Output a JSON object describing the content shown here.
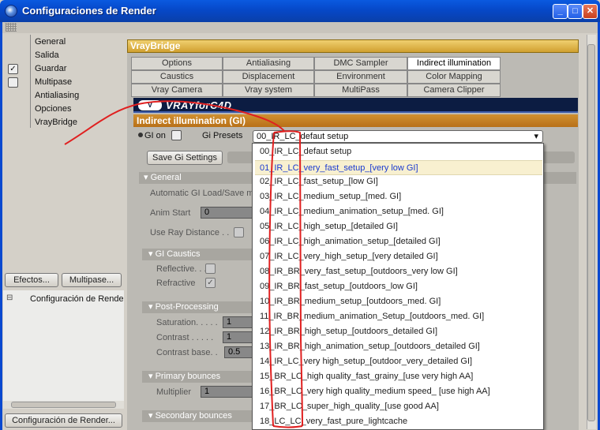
{
  "window": {
    "title": "Configuraciones de Render",
    "min_glyph": "_",
    "max_glyph": "□",
    "close_glyph": "✕"
  },
  "sidebar": {
    "items": [
      {
        "label": "General",
        "checkbox": false
      },
      {
        "label": "Salida",
        "checkbox": false
      },
      {
        "label": "Guardar",
        "checkbox": true,
        "checked": true
      },
      {
        "label": "Multipase",
        "checkbox": true,
        "checked": false
      },
      {
        "label": "Antialiasing",
        "checkbox": false
      },
      {
        "label": "Opciones",
        "checkbox": false
      },
      {
        "label": "VrayBridge",
        "checkbox": false
      }
    ],
    "effects_button": "Efectos...",
    "multipass_button": "Multipase...",
    "render_config_label": "Configuración de Render",
    "render_config_button": "Configuración de Render...",
    "check_glyph": "✓",
    "expand_glyph": "⊟"
  },
  "vraybridge": {
    "header": "VrayBridge",
    "tabs_row1": [
      "Options",
      "Antialiasing",
      "DMC Sampler",
      "Indirect illumination (GI)"
    ],
    "tabs_row2": [
      "Caustics",
      "Displacement",
      "Environment",
      "Color Mapping"
    ],
    "tabs_row3": [
      "Vray Camera",
      "Vray system",
      "MultiPass",
      "Camera Clipper"
    ],
    "active_tab": "Indirect illumination (GI)",
    "logo_text": "VRAYforC4D",
    "logo_mark": "V"
  },
  "gi": {
    "section_header": "Indirect illumination (GI)",
    "gi_on_label": "GI on",
    "gi_presets_label": "Gi Presets",
    "save_button": "Save Gi Settings",
    "general_header": "General",
    "auto_load_label": "Automatic GI Load/Save m",
    "anim_start_label": "Anim Start",
    "anim_start_value": "0",
    "use_ray_distance_label": "Use Ray Distance . .",
    "caustics_header": "GI Caustics",
    "reflective_label": "Reflective. . .",
    "refractive_label": "Refractive",
    "postprocessing_header": "Post-Processing",
    "saturation_label": "Saturation. . . . .",
    "saturation_value": "1",
    "contrast_label": "Contrast . . . . .",
    "contrast_value": "1",
    "contrast_base_label": "Contrast base. .",
    "contrast_base_value": "0.5",
    "primary_header": "Primary bounces",
    "multiplier_label": "Multiplier",
    "multiplier_value": "1",
    "secondary_header": "Secondary bounces",
    "collapse_glyph": "▾"
  },
  "presets_dropdown": {
    "selected": "00_IR_LC_defaut setup",
    "highlighted_index": 1,
    "options": [
      "00_IR_LC_defaut setup",
      "01_IR_LC_very_fast_setup_[very low GI]",
      "02_IR_LC_fast_setup_[low GI]",
      "03_IR_LC_medium_setup_[med. GI]",
      "04_IR_LC_medium_animation_setup_[med. GI]",
      "05_IR_LC_high_setup_[detailed GI]",
      "06_IR_LC_high_animation_setup_[detailed GI]",
      "07_IR_LC_very_high_setup_[very detailed GI]",
      "08_IR_BR_very_fast_setup_[outdoors_very low GI]",
      "09_IR_BR_fast_setup_[outdoors_low GI]",
      "10_IR_BR_medium_setup_[outdoors_med. GI]",
      "11_IR_BR_medium_animation_Setup_[outdoors_med. GI]",
      "12_IR_BR_high_setup_[outdoors_detailed GI]",
      "13_IR_BR_high_animation_setup_[outdoors_detailed GI]",
      "14_IR_LC_very high_setup_[outdoor_very_detailed GI]",
      "15_BR_LC_high quality_fast_grainy_[use very high AA]",
      "16_BR_LC_very high quality_medium speed_ [use high AA]",
      "17_BR_LC_super_high_quality_[use good  AA]",
      "18_LC_LC_very_fast_pure_lightcache"
    ]
  },
  "colors": {
    "titlebar": "#0a49d0",
    "section_orange": "#c8801e",
    "highlight_text": "#1a3ad0",
    "annotation_red": "#e02020"
  }
}
